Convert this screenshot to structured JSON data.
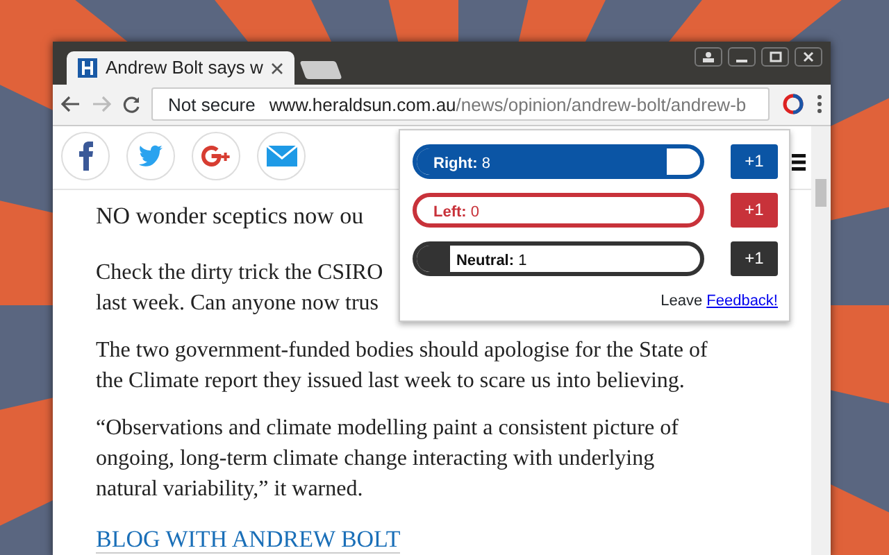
{
  "window": {
    "tab_title": "Andrew Bolt says w",
    "security": "Not secure",
    "url_host": "www.heraldsun.com.au",
    "url_path": "/news/opinion/andrew-bolt/andrew-b"
  },
  "share_buttons": [
    {
      "kind": "facebook"
    },
    {
      "kind": "twitter"
    },
    {
      "kind": "google"
    },
    {
      "kind": "email"
    }
  ],
  "article": {
    "lead": "NO wonder sceptics now ou",
    "paragraphs": [
      [
        "Check the dirty trick the CSIRO",
        "last week. Can anyone now trus"
      ],
      [
        "The two government-funded bodies should apologise for the State of",
        "the Climate report they issued last week to scare us into believing."
      ],
      [
        "“Observations and climate modelling paint a consistent picture of",
        "ongoing, long-term climate change interacting with underlying",
        "natural variability,” it warned."
      ]
    ],
    "blog_link": "BLOG WITH ANDREW BOLT"
  },
  "popup": {
    "rows": [
      {
        "label": "Right:",
        "count": "8",
        "level": 0.88,
        "color": "#0b55a5",
        "button": "+1"
      },
      {
        "label": "Left:",
        "count": "0",
        "level": 0,
        "color": "#c8323a",
        "button": "+1"
      },
      {
        "label": "Neutral:",
        "count": "1",
        "level": 0.12,
        "color": "#333333",
        "button": "+1"
      }
    ],
    "footer": "Leave",
    "feedback_link": "Feedback!"
  }
}
